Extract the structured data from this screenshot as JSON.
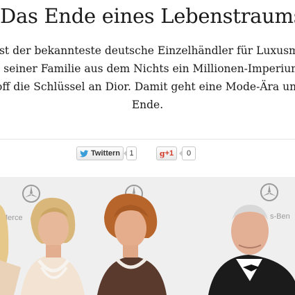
{
  "article": {
    "title": "Das Ende eines Lebenstraums",
    "teaser_lines": [
      "ist der bekannteste deutsche Einzelhändler für Luxusmo",
      "t seiner Familie aus dem Nichts ein Millionen-Imperium",
      "off die Schlüssel an Dior. Damit geht eine Mode-Ära und",
      "Ende."
    ]
  },
  "share": {
    "twitter_label": "Twittern",
    "twitter_count": "1",
    "gplus_label": "+1",
    "gplus_count": "0"
  },
  "photo": {
    "sponsor_text": "Mercedes-Benz",
    "sponsor_text_left": "Merce",
    "sponsor_text_right": "s-Ben"
  },
  "colors": {
    "twitter_bird": "#3a9fd8",
    "gplus": "#d23a2a",
    "backdrop": "#f1f1f1"
  }
}
